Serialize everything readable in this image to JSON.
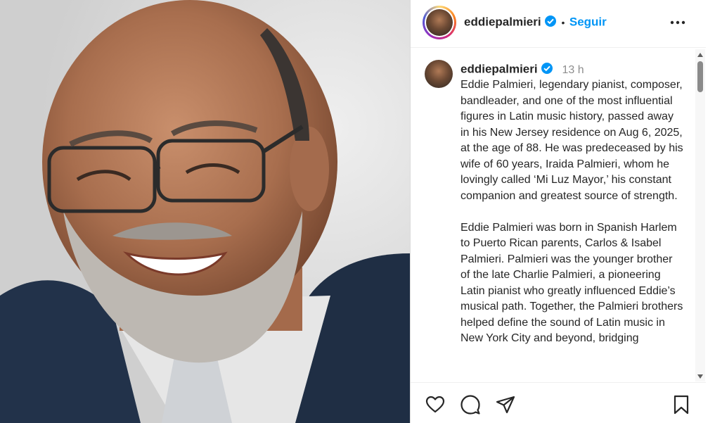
{
  "post": {
    "username": "eddiepalmieri",
    "separator": "•",
    "follow_label": "Seguir",
    "time": "13 h",
    "caption": "Eddie Palmieri, legendary pianist, composer, bandleader, and one of the most influential figures in Latin music history, passed away in his New Jersey residence on Aug 6, 2025, at the age of 88. He was predeceased by his wife of 60 years, Iraida Palmieri, whom he lovingly called ‘Mi Luz Mayor,’ his constant companion and greatest source of strength.\n\nEddie Palmieri was born in Spanish Harlem to Puerto Rican parents, Carlos & Isabel Palmieri. Palmieri was the younger brother of the late Charlie Palmieri, a pioneering Latin pianist who greatly influenced Eddie’s musical path. Together, the Palmieri brothers helped define the sound of Latin music in New York City and beyond, bridging"
  },
  "icons": {
    "verified": "verified-badge-icon",
    "more": "more-options-icon",
    "like": "heart-icon",
    "comment": "comment-icon",
    "share": "share-icon",
    "save": "bookmark-icon"
  },
  "colors": {
    "accent": "#0095f6",
    "text": "#262626",
    "muted": "#8e8e8e"
  }
}
